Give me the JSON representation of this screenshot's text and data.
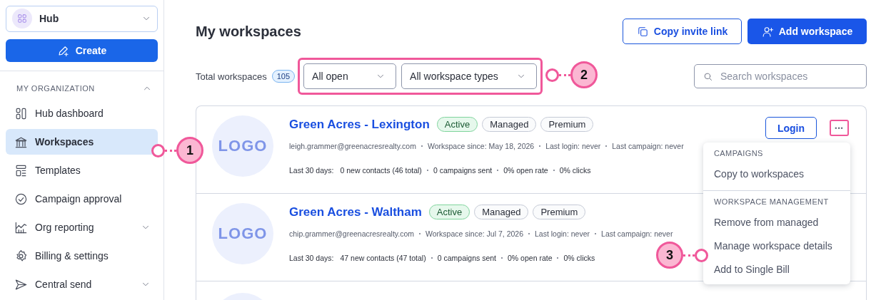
{
  "sidebar": {
    "account": {
      "label": "Hub"
    },
    "create_button": "Create",
    "section": {
      "title": "MY ORGANIZATION",
      "expanded": true
    },
    "items": [
      {
        "label": "Hub dashboard",
        "selected": false,
        "expandable": false
      },
      {
        "label": "Workspaces",
        "selected": true,
        "expandable": false
      },
      {
        "label": "Templates",
        "selected": false,
        "expandable": false
      },
      {
        "label": "Campaign approval",
        "selected": false,
        "expandable": false
      },
      {
        "label": "Org reporting",
        "selected": false,
        "expandable": true
      },
      {
        "label": "Billing & settings",
        "selected": false,
        "expandable": false
      },
      {
        "label": "Central send",
        "selected": false,
        "expandable": true
      }
    ]
  },
  "header": {
    "title": "My workspaces",
    "buttons": [
      {
        "label": "Copy invite link",
        "kind": "outline"
      },
      {
        "label": "Add workspace",
        "kind": "primary"
      }
    ]
  },
  "toolbar": {
    "total_label": "Total workspaces",
    "total_count": "105",
    "filters": [
      "All open",
      "All workspace types"
    ],
    "filters_highlighted": true,
    "search": {
      "placeholder": "Search workspaces"
    }
  },
  "workspaces": [
    {
      "logo": "LOGO",
      "name": "Green Acres - Lexington",
      "badges": [
        {
          "label": "Active",
          "kind": "status"
        },
        {
          "label": "Managed",
          "kind": "tag"
        },
        {
          "label": "Premium",
          "kind": "tag"
        }
      ],
      "meta": [
        "leigh.grammer@greenacresrealty.com",
        "Workspace since: May 18, 2026",
        "Last login: never",
        "Last campaign: never"
      ],
      "stats_label": "Last 30 days:",
      "stats": [
        "0 new contacts (46 total)",
        "0 campaigns sent",
        "0% open rate",
        "0% clicks"
      ],
      "login": "Login",
      "more": "•••",
      "more_highlighted": true
    },
    {
      "logo": "LOGO",
      "name": "Green Acres - Waltham",
      "badges": [
        {
          "label": "Active",
          "kind": "status"
        },
        {
          "label": "Managed",
          "kind": "tag"
        },
        {
          "label": "Premium",
          "kind": "tag"
        }
      ],
      "meta": [
        "chip.grammer@greenacresrealty.com",
        "Workspace since: Jul 7, 2026",
        "Last login: never",
        "Last campaign: never"
      ],
      "stats_label": "Last 30 days:",
      "stats": [
        "47 new contacts (47 total)",
        "0 campaigns sent",
        "0% open rate",
        "0% clicks"
      ]
    }
  ],
  "menu": {
    "sections": [
      {
        "title": "CAMPAIGNS",
        "items": [
          "Copy to workspaces"
        ]
      },
      {
        "title": "WORKSPACE MANAGEMENT",
        "items": [
          "Remove from managed",
          "Manage workspace details",
          "Add to Single Bill"
        ]
      }
    ]
  },
  "callouts": [
    {
      "number": "1"
    },
    {
      "number": "2"
    },
    {
      "number": "3"
    }
  ]
}
